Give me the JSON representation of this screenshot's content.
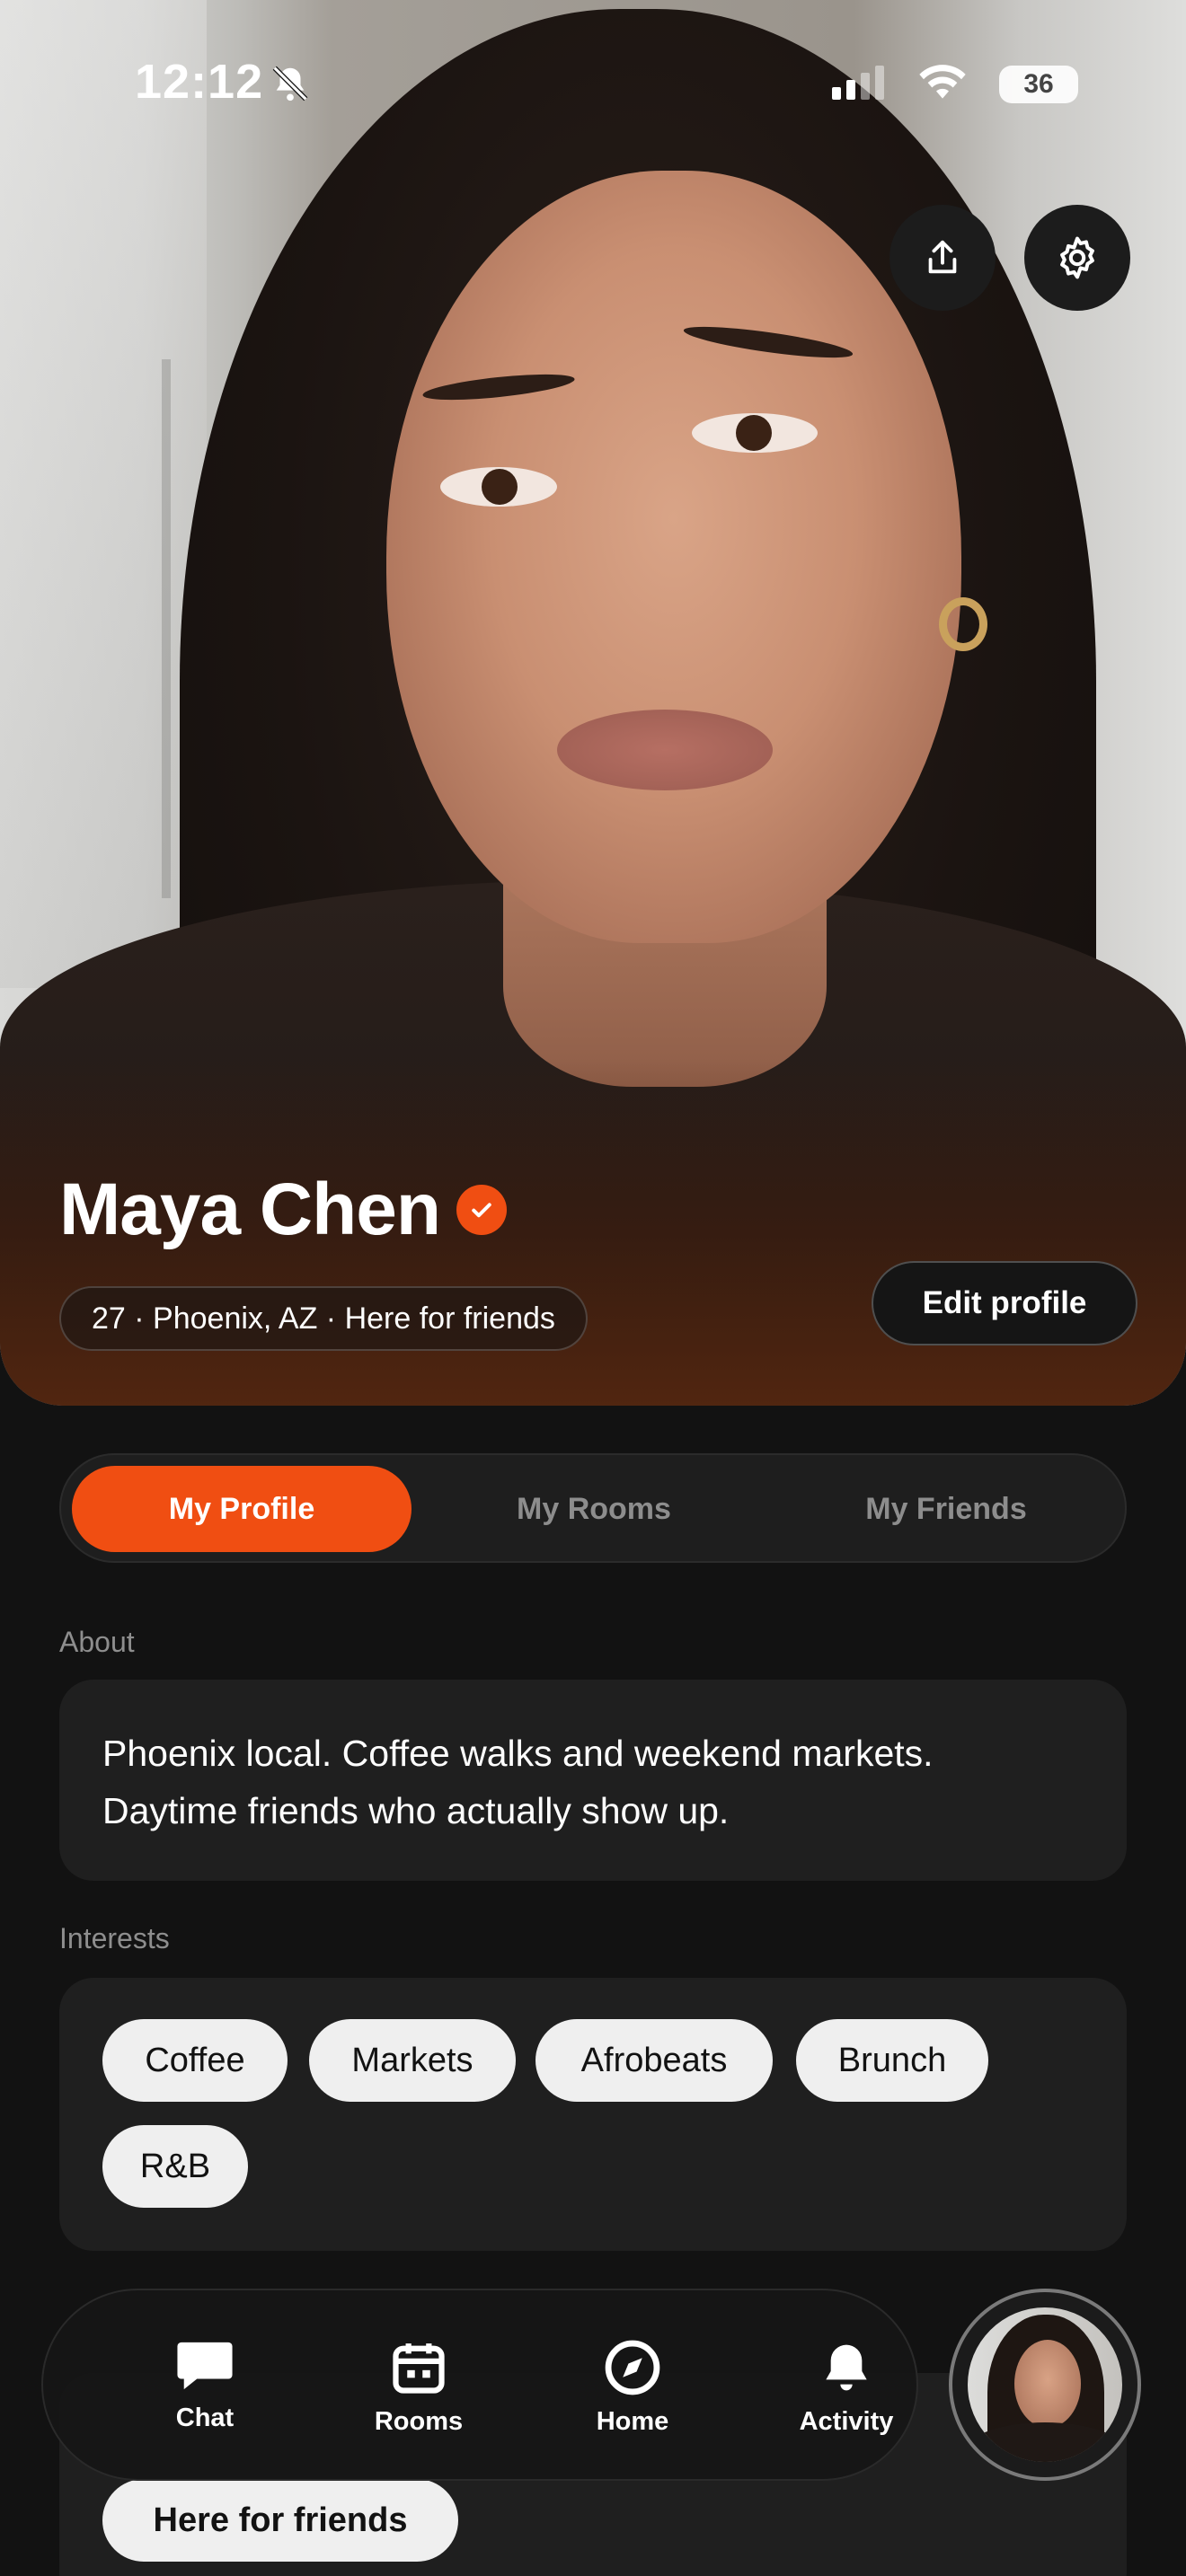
{
  "status_bar": {
    "time": "12:12",
    "battery": "36"
  },
  "profile": {
    "name": "Maya Chen",
    "meta": "27 · Phoenix, AZ · Here for friends",
    "edit_label": "Edit profile"
  },
  "tabs": [
    {
      "label": "My Profile",
      "active": true
    },
    {
      "label": "My Rooms",
      "active": false
    },
    {
      "label": "My Friends",
      "active": false
    }
  ],
  "about": {
    "label": "About",
    "text": "Phoenix local. Coffee walks and weekend markets. Daytime friends who actually show up."
  },
  "interests": {
    "label": "Interests",
    "items": [
      "Coffee",
      "Markets",
      "Afrobeats",
      "Brunch",
      "R&B"
    ]
  },
  "intent_chip": "Here for friends",
  "nav": [
    {
      "label": "Chat",
      "icon": "chat-bubble-icon"
    },
    {
      "label": "Rooms",
      "icon": "calendar-icon"
    },
    {
      "label": "Home",
      "icon": "compass-icon"
    },
    {
      "label": "Activity",
      "icon": "bell-icon"
    }
  ],
  "colors": {
    "accent": "#f04e12",
    "background": "#121212",
    "card": "#1f1f1f"
  }
}
